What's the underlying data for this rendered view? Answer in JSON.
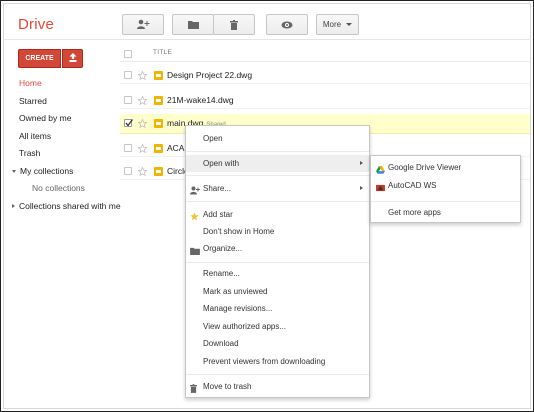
{
  "app": {
    "logo": "Drive"
  },
  "toolbar": {
    "add_people_icon": "add-person-icon",
    "folder_icon": "folder-icon",
    "trash_icon": "trash-icon",
    "preview_icon": "eye-icon",
    "more_label": "More"
  },
  "sidebar": {
    "create_label": "CREATE",
    "items": [
      {
        "label": "Home",
        "active": true
      },
      {
        "label": "Starred"
      },
      {
        "label": "Owned by me"
      },
      {
        "label": "All items"
      },
      {
        "label": "Trash"
      }
    ],
    "my_collections": "My collections",
    "no_collections": "No collections",
    "shared_collections": "Collections shared with me"
  },
  "list": {
    "title_header": "TITLE",
    "rows": [
      {
        "name": "Design Project 22.dwg",
        "checked": false,
        "selected": false
      },
      {
        "name": "21M-wake14.dwg",
        "checked": false,
        "selected": false
      },
      {
        "name": "main.dwg",
        "tag": "Shared",
        "checked": true,
        "selected": true
      },
      {
        "name": "ACA",
        "checked": false,
        "selected": false
      },
      {
        "name": "Circle",
        "checked": false,
        "selected": false
      }
    ]
  },
  "context_menu": {
    "items": [
      {
        "label": "Open"
      },
      {
        "label": "Open with",
        "submenu": true,
        "highlight": true
      },
      {
        "label": "Share...",
        "icon": "share-person-icon",
        "submenu": true
      },
      {
        "label": "Add star",
        "icon": "star-icon"
      },
      {
        "label": "Don't show in Home"
      },
      {
        "label": "Organize...",
        "icon": "folder-icon"
      },
      {
        "label": "Rename..."
      },
      {
        "label": "Mark as unviewed"
      },
      {
        "label": "Manage revisions..."
      },
      {
        "label": "View authorized apps..."
      },
      {
        "label": "Download"
      },
      {
        "label": "Prevent viewers from downloading"
      },
      {
        "label": "Move to trash",
        "icon": "trash-icon"
      }
    ]
  },
  "open_with_menu": {
    "items": [
      {
        "label": "Google Drive Viewer",
        "icon": "drive-icon"
      },
      {
        "label": "AutoCAD WS",
        "icon": "autocad-icon"
      },
      {
        "label": "Get more apps"
      }
    ]
  },
  "colors": {
    "brand_red": "#dd4b39",
    "create_button": "#d14836",
    "selected_row": "#ffffcc",
    "file_icon": "#f2b400"
  }
}
